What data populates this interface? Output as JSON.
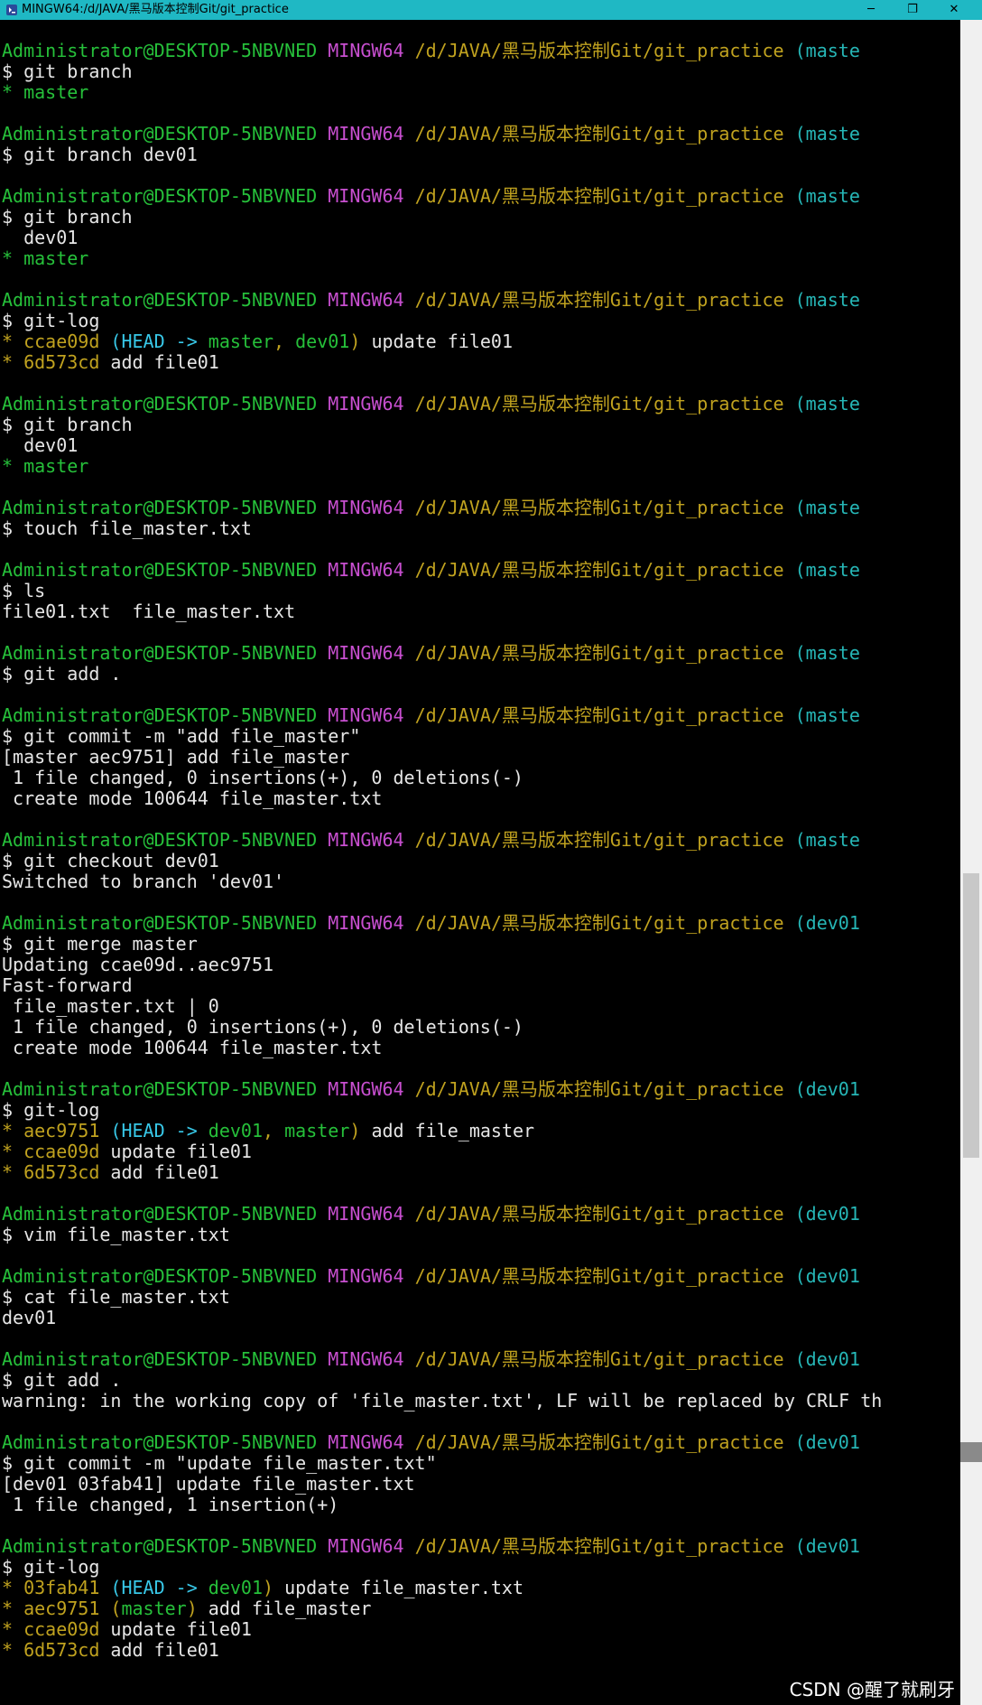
{
  "window": {
    "title": "MINGW64:/d/JAVA/黑马版本控制Git/git_practice",
    "minimize_glyph": "─",
    "maximize_glyph": "❐",
    "close_glyph": "✕"
  },
  "prompt": {
    "user": "Administrator@DESKTOP-5NBVNED",
    "system": "MINGW64",
    "path": "/d/JAVA/黑马版本控制Git/git_practice",
    "branch_master": "(maste",
    "branch_dev01": "(dev01"
  },
  "blocks": [
    {
      "branch": "branch_master",
      "command": "$ git branch",
      "output": [
        {
          "segs": [
            {
              "c": "gr",
              "t": "* master"
            }
          ]
        }
      ]
    },
    {
      "branch": "branch_master",
      "command": "$ git branch dev01",
      "output": []
    },
    {
      "branch": "branch_master",
      "command": "$ git branch",
      "output": [
        {
          "segs": [
            {
              "c": "w",
              "t": "  dev01"
            }
          ]
        },
        {
          "segs": [
            {
              "c": "gr",
              "t": "* master"
            }
          ]
        }
      ]
    },
    {
      "branch": "branch_master",
      "command": "$ git-log",
      "output": [
        {
          "segs": [
            {
              "c": "h",
              "t": "* ccae09d "
            },
            {
              "c": "hd",
              "t": "(HEAD -> "
            },
            {
              "c": "gr",
              "t": "master"
            },
            {
              "c": "h",
              "t": ", "
            },
            {
              "c": "gr",
              "t": "dev01"
            },
            {
              "c": "h",
              "t": ")"
            },
            {
              "c": "w",
              "t": " update file01"
            }
          ]
        },
        {
          "segs": [
            {
              "c": "h",
              "t": "* 6d573cd"
            },
            {
              "c": "w",
              "t": " add file01"
            }
          ]
        }
      ]
    },
    {
      "branch": "branch_master",
      "command": "$ git branch",
      "output": [
        {
          "segs": [
            {
              "c": "w",
              "t": "  dev01"
            }
          ]
        },
        {
          "segs": [
            {
              "c": "gr",
              "t": "* master"
            }
          ]
        }
      ]
    },
    {
      "branch": "branch_master",
      "command": "$ touch file_master.txt",
      "output": []
    },
    {
      "branch": "branch_master",
      "command": "$ ls",
      "output": [
        {
          "segs": [
            {
              "c": "w",
              "t": "file01.txt  file_master.txt"
            }
          ]
        }
      ]
    },
    {
      "branch": "branch_master",
      "command": "$ git add .",
      "output": []
    },
    {
      "branch": "branch_master",
      "command": "$ git commit -m \"add file_master\"",
      "output": [
        {
          "segs": [
            {
              "c": "w",
              "t": "[master aec9751] add file_master"
            }
          ]
        },
        {
          "segs": [
            {
              "c": "w",
              "t": " 1 file changed, 0 insertions(+), 0 deletions(-)"
            }
          ]
        },
        {
          "segs": [
            {
              "c": "w",
              "t": " create mode 100644 file_master.txt"
            }
          ]
        }
      ]
    },
    {
      "branch": "branch_master",
      "command": "$ git checkout dev01",
      "output": [
        {
          "segs": [
            {
              "c": "w",
              "t": "Switched to branch 'dev01'"
            }
          ]
        }
      ]
    },
    {
      "branch": "branch_dev01",
      "command": "$ git merge master",
      "output": [
        {
          "segs": [
            {
              "c": "w",
              "t": "Updating ccae09d..aec9751"
            }
          ]
        },
        {
          "segs": [
            {
              "c": "w",
              "t": "Fast-forward"
            }
          ]
        },
        {
          "segs": [
            {
              "c": "w",
              "t": " file_master.txt | 0"
            }
          ]
        },
        {
          "segs": [
            {
              "c": "w",
              "t": " 1 file changed, 0 insertions(+), 0 deletions(-)"
            }
          ]
        },
        {
          "segs": [
            {
              "c": "w",
              "t": " create mode 100644 file_master.txt"
            }
          ]
        }
      ]
    },
    {
      "branch": "branch_dev01",
      "command": "$ git-log",
      "output": [
        {
          "segs": [
            {
              "c": "h",
              "t": "* aec9751 "
            },
            {
              "c": "hd",
              "t": "(HEAD -> "
            },
            {
              "c": "gr",
              "t": "dev01"
            },
            {
              "c": "h",
              "t": ", "
            },
            {
              "c": "gr",
              "t": "master"
            },
            {
              "c": "h",
              "t": ")"
            },
            {
              "c": "w",
              "t": " add file_master"
            }
          ]
        },
        {
          "segs": [
            {
              "c": "h",
              "t": "* ccae09d"
            },
            {
              "c": "w",
              "t": " update file01"
            }
          ]
        },
        {
          "segs": [
            {
              "c": "h",
              "t": "* 6d573cd"
            },
            {
              "c": "w",
              "t": " add file01"
            }
          ]
        }
      ]
    },
    {
      "branch": "branch_dev01",
      "command": "$ vim file_master.txt",
      "output": []
    },
    {
      "branch": "branch_dev01",
      "command": "$ cat file_master.txt",
      "output": [
        {
          "segs": [
            {
              "c": "w",
              "t": "dev01"
            }
          ]
        }
      ]
    },
    {
      "branch": "branch_dev01",
      "command": "$ git add .",
      "output": [
        {
          "segs": [
            {
              "c": "w",
              "t": "warning: in the working copy of 'file_master.txt', LF will be replaced by CRLF th"
            }
          ]
        }
      ]
    },
    {
      "branch": "branch_dev01",
      "command": "$ git commit -m \"update file_master.txt\"",
      "output": [
        {
          "segs": [
            {
              "c": "w",
              "t": "[dev01 03fab41] update file_master.txt"
            }
          ]
        },
        {
          "segs": [
            {
              "c": "w",
              "t": " 1 file changed, 1 insertion(+)"
            }
          ]
        }
      ]
    },
    {
      "branch": "branch_dev01",
      "command": "$ git-log",
      "output": [
        {
          "segs": [
            {
              "c": "h",
              "t": "* 03fab41 "
            },
            {
              "c": "hd",
              "t": "(HEAD -> "
            },
            {
              "c": "gr",
              "t": "dev01"
            },
            {
              "c": "h",
              "t": ")"
            },
            {
              "c": "w",
              "t": " update file_master.txt"
            }
          ]
        },
        {
          "segs": [
            {
              "c": "h",
              "t": "* aec9751 "
            },
            {
              "c": "h",
              "t": "("
            },
            {
              "c": "gr",
              "t": "master"
            },
            {
              "c": "h",
              "t": ")"
            },
            {
              "c": "w",
              "t": " add file_master"
            }
          ]
        },
        {
          "segs": [
            {
              "c": "h",
              "t": "* ccae09d"
            },
            {
              "c": "w",
              "t": " update file01"
            }
          ]
        },
        {
          "segs": [
            {
              "c": "h",
              "t": "* 6d573cd"
            },
            {
              "c": "w",
              "t": " add file01"
            }
          ]
        }
      ]
    }
  ],
  "watermark": "CSDN @醒了就刷牙",
  "colors": {
    "titlebar": "#1fb8c4",
    "user": "#26c03a",
    "system": "#c84fd0",
    "path": "#c0a21f",
    "branch": "#26b6b6",
    "hash": "#c0a21f",
    "head": "#38c8e8",
    "ref": "#26c03a",
    "text": "#e6e6e6"
  }
}
